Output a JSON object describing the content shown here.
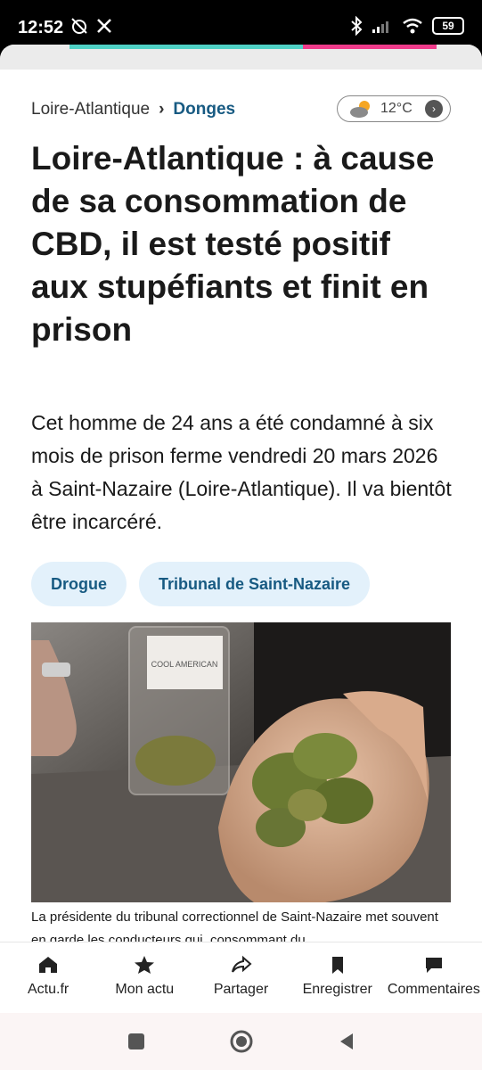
{
  "status_bar": {
    "time": "12:52",
    "battery": "59"
  },
  "breadcrumb": {
    "region": "Loire-Atlantique",
    "separator": "›",
    "city": "Donges"
  },
  "weather": {
    "temperature": "12°C",
    "icon": "sun-cloud-icon"
  },
  "article": {
    "headline": "Loire-Atlantique : à cause de sa consommation de CBD, il est testé positif aux stupéfiants et finit en prison",
    "lead": "Cet homme de 24 ans a été condamné à six mois de prison ferme vendredi 20 mars 2026 à Saint-Nazaire (Loire-Atlantique). Il va bientôt être incarcéré.",
    "tags": [
      "Drogue",
      "Tribunal de Saint-Nazaire"
    ],
    "jar_label": "COOL AMERICAN",
    "caption": "La présidente du tribunal correctionnel de Saint-Nazaire met souvent en garde les conducteurs qui, consommant du"
  },
  "bottom_nav": {
    "items": [
      {
        "label": "Actu.fr",
        "icon": "home-icon"
      },
      {
        "label": "Mon actu",
        "icon": "star-icon"
      },
      {
        "label": "Partager",
        "icon": "share-icon"
      },
      {
        "label": "Enregistrer",
        "icon": "bookmark-icon"
      },
      {
        "label": "Commentaires",
        "icon": "comment-icon"
      }
    ]
  },
  "colors": {
    "accent": "#175a82",
    "tag_bg": "#e3f1fb"
  }
}
